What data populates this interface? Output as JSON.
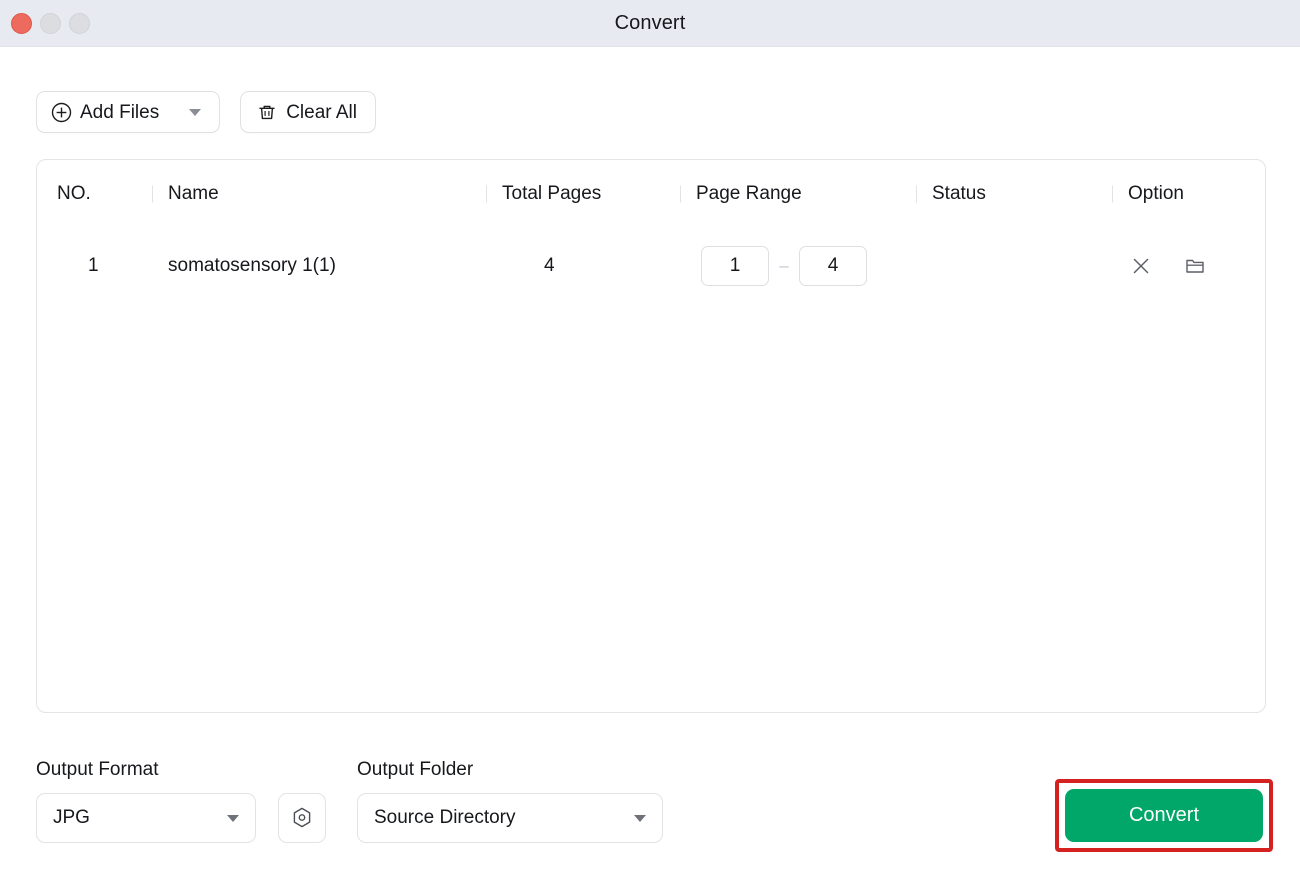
{
  "window": {
    "title": "Convert",
    "controls": {
      "close": "close-button",
      "minimize": "minimize-button",
      "maximize": "maximize-button"
    },
    "titlebar_color": "#e8eaf1",
    "close_color": "#ec6a5e"
  },
  "toolbar": {
    "add_files_label": "Add Files",
    "add_files_icon": "plus-circle-icon",
    "add_files_caret_icon": "chevron-down-icon",
    "clear_all_label": "Clear All",
    "clear_all_icon": "trash-icon"
  },
  "table": {
    "columns": [
      {
        "key": "no",
        "label": "NO."
      },
      {
        "key": "name",
        "label": "Name"
      },
      {
        "key": "total_pages",
        "label": "Total Pages"
      },
      {
        "key": "page_range",
        "label": "Page Range"
      },
      {
        "key": "status",
        "label": "Status"
      },
      {
        "key": "option",
        "label": "Option"
      }
    ],
    "rows": [
      {
        "no": "1",
        "name": "somatosensory 1(1)",
        "total_pages": "4",
        "page_range_start": "1",
        "page_range_end": "4",
        "page_range_separator": "–",
        "status": "",
        "remove_icon": "close-x-icon",
        "folder_icon": "folder-icon"
      }
    ]
  },
  "bottom": {
    "output_format_label": "Output Format",
    "output_format_value": "JPG",
    "output_format_caret_icon": "chevron-down-icon",
    "settings_icon": "settings-hexagon-icon",
    "output_folder_label": "Output Folder",
    "output_folder_value": "Source Directory",
    "output_folder_caret_icon": "chevron-down-icon",
    "convert_label": "Convert",
    "convert_color": "#00a768",
    "highlight_color": "#d62121"
  }
}
